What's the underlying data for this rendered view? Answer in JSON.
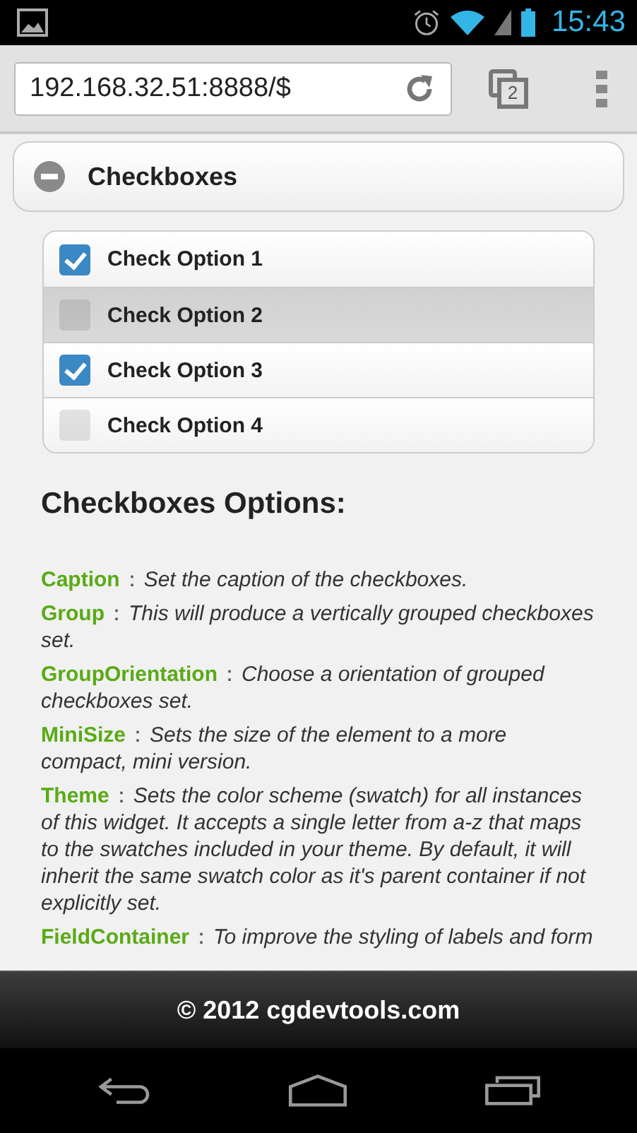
{
  "status_bar": {
    "time": "15:43"
  },
  "browser": {
    "url": "192.168.32.51:8888/$",
    "tab_count": "2"
  },
  "collapsible": {
    "title": "Checkboxes",
    "expanded": true
  },
  "checkboxes": [
    {
      "label": "Check Option 1",
      "checked": true,
      "highlighted": false
    },
    {
      "label": "Check Option 2",
      "checked": false,
      "highlighted": true
    },
    {
      "label": "Check Option 3",
      "checked": true,
      "highlighted": false
    },
    {
      "label": "Check Option 4",
      "checked": false,
      "highlighted": false
    }
  ],
  "options_heading": "Checkboxes Options:",
  "options": [
    {
      "name": "Caption",
      "separator": "：",
      "description": "Set the caption of the checkboxes."
    },
    {
      "name": "Group",
      "separator": "：",
      "description": "This will produce a vertically grouped checkboxes set."
    },
    {
      "name": "GroupOrientation",
      "separator": "：",
      "description": "Choose a orientation of grouped checkboxes set."
    },
    {
      "name": "MiniSize",
      "separator": "：",
      "description": "Sets the size of the element to a more compact, mini version."
    },
    {
      "name": "Theme",
      "separator": "：",
      "description": "Sets the color scheme (swatch) for all instances of this widget. It accepts a single letter from a-z that maps to the swatches included in your theme. By default, it will inherit the same swatch color as it's parent container if not explicitly set."
    },
    {
      "name": "FieldContainer",
      "separator": "：",
      "description": "To improve the styling of labels and form"
    }
  ],
  "footer": "© 2012 cgdevtools.com"
}
